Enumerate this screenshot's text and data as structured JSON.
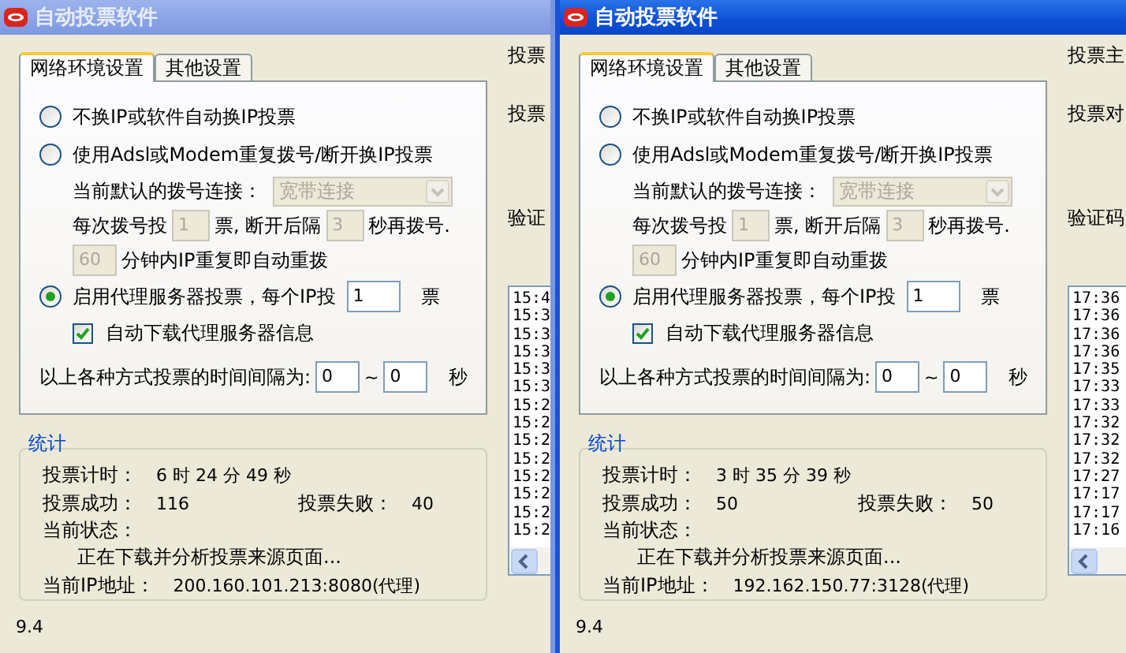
{
  "windows": [
    {
      "title": "自动投票软件",
      "active": false,
      "tabs": [
        {
          "label": "网络环境设置",
          "selected": true
        },
        {
          "label": "其他设置",
          "selected": false
        }
      ],
      "modes": [
        {
          "kind": "plain",
          "label": "不换IP或软件自动换IP投票",
          "selected": false
        },
        {
          "kind": "dialup",
          "label": "使用Adsl或Modem重复拨号/断开换IP投票",
          "selected": false,
          "connection_label": "当前默认的拨号连接：",
          "connection_value": "宽带连接",
          "votes_label": "每次拨号投",
          "votes_value": "1",
          "votes_unit": "票, 断开后隔",
          "wait_value": "3",
          "wait_unit": "秒再拨号.",
          "repeat_value": "60",
          "repeat_label": "分钟内IP重复即自动重拨"
        },
        {
          "kind": "proxy",
          "label": "启用代理服务器投票，每个IP投",
          "selected": true,
          "votes_value": "1",
          "votes_unit": "票",
          "auto_download": {
            "label": "自动下载代理服务器信息",
            "checked": true
          }
        }
      ],
      "interval": {
        "label": "以上各种方式投票的时间间隔为:",
        "from": "0",
        "sep": "~",
        "to": "0",
        "unit": "秒"
      },
      "stats": {
        "title": "统计",
        "timer_label": "投票计时：",
        "timer": "6 时 24 分 49 秒",
        "success_label": "投票成功：",
        "success": "116",
        "fail_label": "投票失败：",
        "fail": "40",
        "status_label": "当前状态：",
        "status": "正在下载并分析投票来源页面...",
        "ip_label": "当前IP地址：",
        "ip": "200.160.101.213:8080(代理)"
      },
      "version": "9.4",
      "side_labels": [
        "投票",
        "投票",
        "验证"
      ],
      "log": [
        "15:4",
        "15:3",
        "15:3",
        "15:3",
        "15:3",
        "15:3",
        "15:2",
        "15:2",
        "15:2",
        "15:2",
        "15:2",
        "15:2",
        "15:2",
        "15:2"
      ]
    },
    {
      "title": "自动投票软件",
      "active": true,
      "tabs": [
        {
          "label": "网络环境设置",
          "selected": true
        },
        {
          "label": "其他设置",
          "selected": false
        }
      ],
      "modes": [
        {
          "kind": "plain",
          "label": "不换IP或软件自动换IP投票",
          "selected": false
        },
        {
          "kind": "dialup",
          "label": "使用Adsl或Modem重复拨号/断开换IP投票",
          "selected": false,
          "connection_label": "当前默认的拨号连接：",
          "connection_value": "宽带连接",
          "votes_label": "每次拨号投",
          "votes_value": "1",
          "votes_unit": "票, 断开后隔",
          "wait_value": "3",
          "wait_unit": "秒再拨号.",
          "repeat_value": "60",
          "repeat_label": "分钟内IP重复即自动重拨"
        },
        {
          "kind": "proxy",
          "label": "启用代理服务器投票，每个IP投",
          "selected": true,
          "votes_value": "1",
          "votes_unit": "票",
          "auto_download": {
            "label": "自动下载代理服务器信息",
            "checked": true
          }
        }
      ],
      "interval": {
        "label": "以上各种方式投票的时间间隔为:",
        "from": "0",
        "sep": "~",
        "to": "0",
        "unit": "秒"
      },
      "stats": {
        "title": "统计",
        "timer_label": "投票计时：",
        "timer": "3 时 35 分 39 秒",
        "success_label": "投票成功：",
        "success": "50",
        "fail_label": "投票失败：",
        "fail": "50",
        "status_label": "当前状态：",
        "status": "正在下载并分析投票来源页面...",
        "ip_label": "当前IP地址：",
        "ip": "192.162.150.77:3128(代理)"
      },
      "version": "9.4",
      "side_labels": [
        "投票主",
        "投票对",
        "验证码"
      ],
      "log": [
        "17:36",
        "17:36",
        "17:36",
        "17:36",
        "17:35",
        "17:33",
        "17:33",
        "17:32",
        "17:32",
        "17:32",
        "17:27",
        "17:17",
        "17:17",
        "17:16"
      ]
    }
  ]
}
